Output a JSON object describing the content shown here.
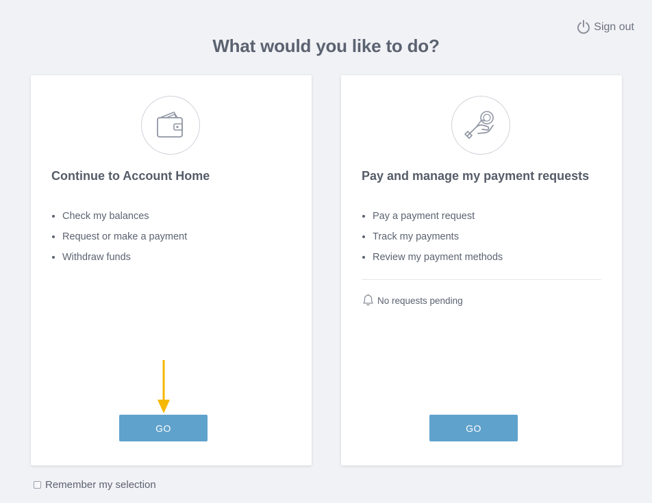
{
  "header": {
    "signout_label": "Sign out",
    "signout_icon": "power-icon",
    "title": "What would you like to do?"
  },
  "cards": [
    {
      "icon": "wallet-icon",
      "title": "Continue to Account Home",
      "features": [
        "Check my balances",
        "Request or make a payment",
        "Withdraw funds"
      ],
      "button_label": "GO",
      "annotation": "arrow-down-icon",
      "annotation_color": "#f5b800"
    },
    {
      "icon": "hand-coin-icon",
      "title": "Pay and manage my payment requests",
      "features": [
        "Pay a payment request",
        "Track my payments",
        "Review my payment methods"
      ],
      "status_icon": "bell-icon",
      "status_text": "No requests pending",
      "button_label": "GO"
    }
  ],
  "footer": {
    "remember_label": "Remember my selection",
    "remember_checked": false
  },
  "colors": {
    "background": "#f1f2f6",
    "button": "#5fa2cc",
    "text": "#5b6270",
    "arrow": "#f5b800"
  }
}
